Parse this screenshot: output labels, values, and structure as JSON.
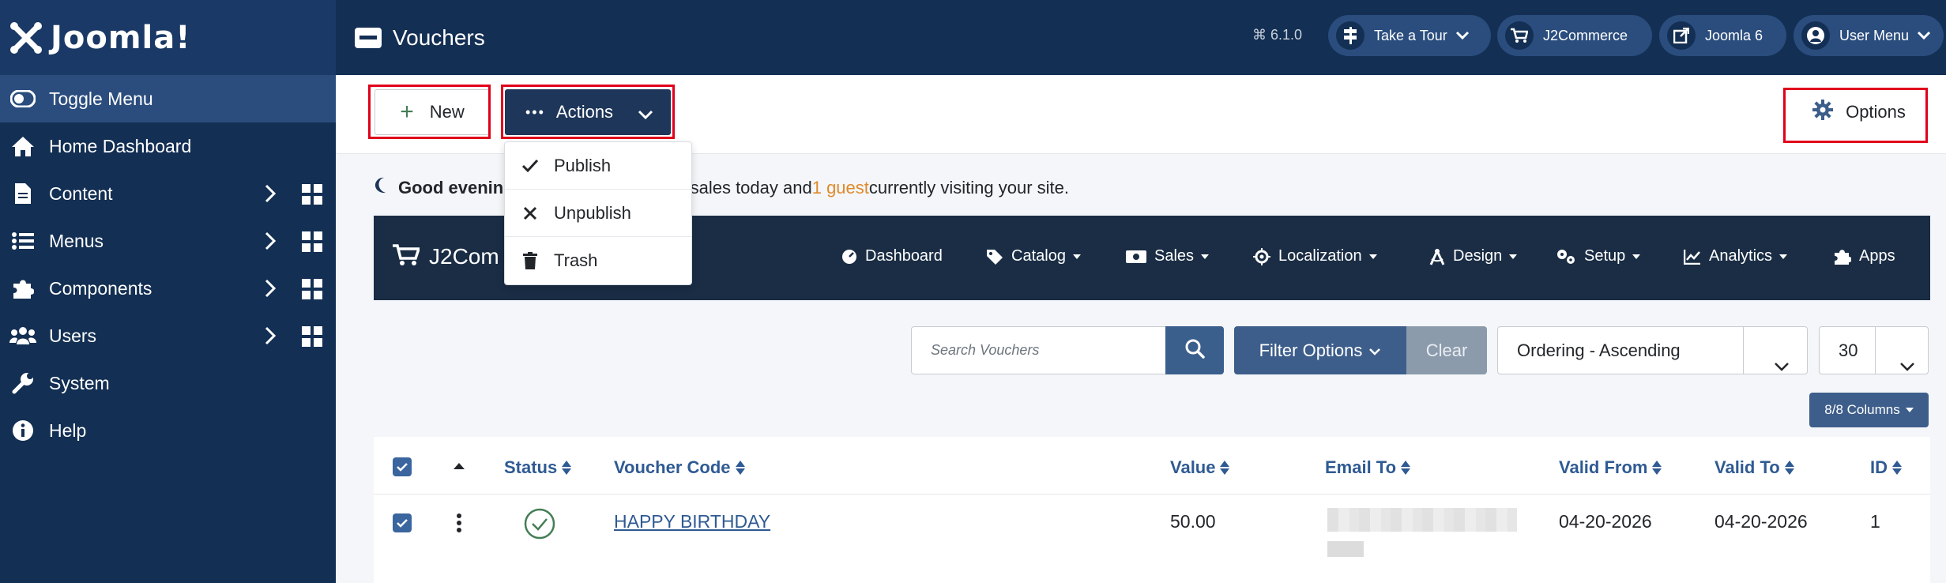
{
  "brand": {
    "name": "Joomla!"
  },
  "sidebar": {
    "items": [
      {
        "label": "Toggle Menu",
        "icon": "toggle-icon"
      },
      {
        "label": "Home Dashboard",
        "icon": "home-icon"
      },
      {
        "label": "Content",
        "icon": "file-icon"
      },
      {
        "label": "Menus",
        "icon": "list-icon"
      },
      {
        "label": "Components",
        "icon": "puzzle-icon"
      },
      {
        "label": "Users",
        "icon": "users-icon"
      },
      {
        "label": "System",
        "icon": "wrench-icon"
      },
      {
        "label": "Help",
        "icon": "info-icon"
      }
    ]
  },
  "header": {
    "title": "Vouchers",
    "version": "6.1.0",
    "take_tour": "Take a Tour",
    "j2commerce": "J2Commerce",
    "joomla6": "Joomla 6",
    "user_menu": "User Menu"
  },
  "toolbar": {
    "new_label": "New",
    "actions_label": "Actions",
    "options_label": "Options"
  },
  "actions_menu": [
    {
      "label": "Publish",
      "icon": "check-icon"
    },
    {
      "label": "Unpublish",
      "icon": "x-icon"
    },
    {
      "label": "Trash",
      "icon": "trash-icon"
    }
  ],
  "greeting": {
    "bold": "Good evenin",
    "middle": "n sales today and ",
    "guest": "1 guest",
    "tail": " currently visiting your site."
  },
  "j2": {
    "title": "J2Com",
    "nav": [
      "Dashboard",
      "Catalog",
      "Sales",
      "Localization",
      "Design",
      "Setup",
      "Analytics",
      "Apps"
    ]
  },
  "filters": {
    "search_placeholder": "Search Vouchers",
    "filter_options": "Filter Options",
    "clear": "Clear",
    "ordering": "Ordering - Ascending",
    "limit": "30",
    "columns": "8/8 Columns"
  },
  "table": {
    "headers": {
      "status": "Status",
      "code": "Voucher Code",
      "value": "Value",
      "email": "Email To",
      "valid_from": "Valid From",
      "valid_to": "Valid To",
      "id": "ID"
    },
    "rows": [
      {
        "code": "HAPPY BIRTHDAY",
        "value": "50.00",
        "valid_from": "04-20-2026",
        "valid_to": "04-20-2026",
        "id": "1",
        "published": true
      }
    ]
  },
  "colors": {
    "sidebar": "#132f53",
    "accent": "#3d5e8a",
    "highlight": "#e0001b",
    "guest": "#e08a2b"
  }
}
